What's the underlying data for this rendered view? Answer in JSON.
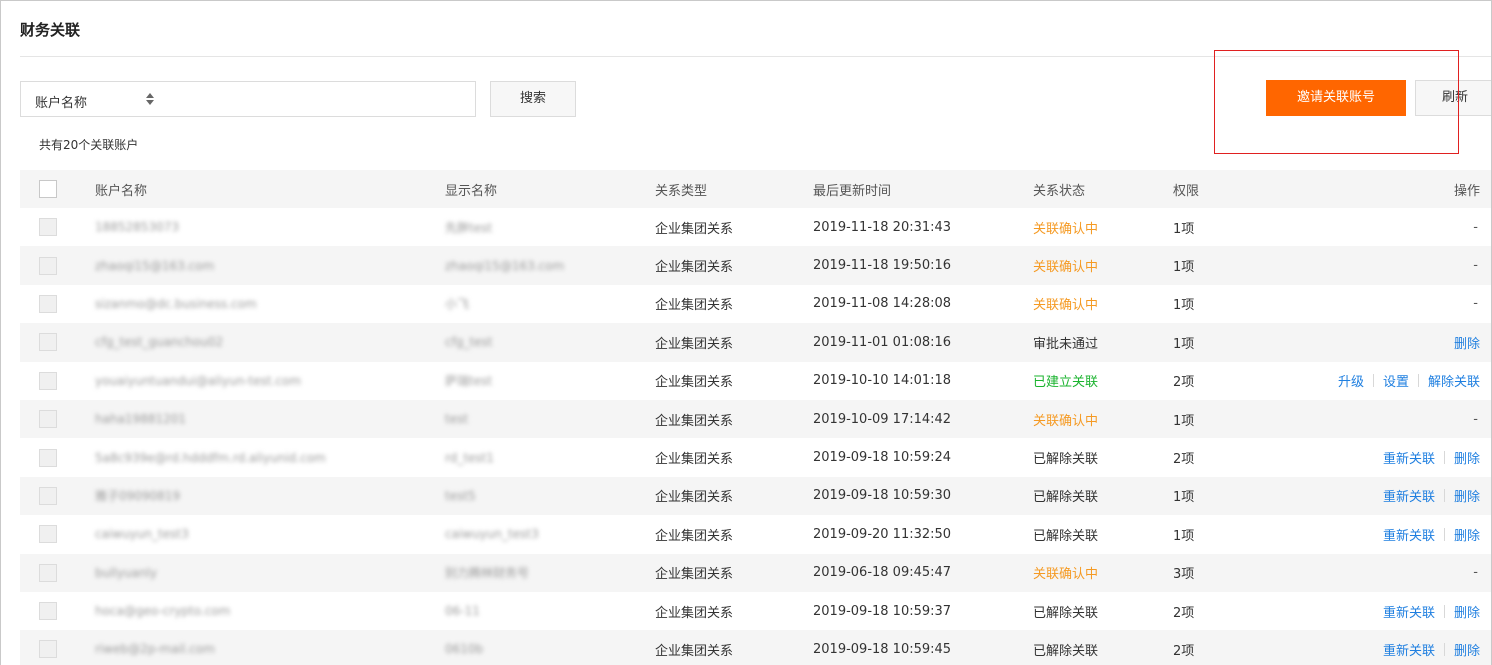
{
  "header": {
    "title": "财务关联"
  },
  "search": {
    "field_label": "账户名称",
    "search_button": "搜索"
  },
  "actions": {
    "invite_button": "邀请关联账号",
    "refresh_button": "刷新"
  },
  "summary": {
    "count_text": "共有20个关联账户"
  },
  "table": {
    "columns": [
      "账户名称",
      "显示名称",
      "关系类型",
      "最后更新时间",
      "关系状态",
      "权限",
      "操作"
    ],
    "rows": [
      {
        "account": "18852853073",
        "display": "先胖test",
        "type": "企业集团关系",
        "time": "2019-11-18 20:31:43",
        "status": "关联确认中",
        "status_kind": "pending",
        "perm": "1项",
        "ops": [
          "-"
        ]
      },
      {
        "account": "zhaoqi15@163.com",
        "display": "zhaoqi15@163.com",
        "type": "企业集团关系",
        "time": "2019-11-18 19:50:16",
        "status": "关联确认中",
        "status_kind": "pending",
        "perm": "1项",
        "ops": [
          "-"
        ]
      },
      {
        "account": "sizanmo@dc.business.com",
        "display": "小飞",
        "type": "企业集团关系",
        "time": "2019-11-08 14:28:08",
        "status": "关联确认中",
        "status_kind": "pending",
        "perm": "1项",
        "ops": [
          "-"
        ]
      },
      {
        "account": "cfg_test_guanchou02",
        "display": "cfg_test",
        "type": "企业集团关系",
        "time": "2019-11-01 01:08:16",
        "status": "审批未通过",
        "status_kind": "plain",
        "perm": "1项",
        "ops": [
          "删除"
        ]
      },
      {
        "account": "youaiyuntuandui@aliyun-test.com",
        "display": "萨瑞test",
        "type": "企业集团关系",
        "time": "2019-10-10 14:01:18",
        "status": "已建立关联",
        "status_kind": "ok",
        "perm": "2项",
        "ops": [
          "升级",
          "设置",
          "解除关联"
        ]
      },
      {
        "account": "haha19881201",
        "display": "test",
        "type": "企业集团关系",
        "time": "2019-10-09 17:14:42",
        "status": "关联确认中",
        "status_kind": "pending",
        "perm": "1项",
        "ops": [
          "-"
        ]
      },
      {
        "account": "5a8c939e@rd.hdddfm.rd.aliyunid.com",
        "display": "rd_test1",
        "type": "企业集团关系",
        "time": "2019-09-18 10:59:24",
        "status": "已解除关联",
        "status_kind": "plain",
        "perm": "2项",
        "ops": [
          "重新关联",
          "删除"
        ]
      },
      {
        "account": "雅子09090819",
        "display": "test5",
        "type": "企业集团关系",
        "time": "2019-09-18 10:59:30",
        "status": "已解除关联",
        "status_kind": "plain",
        "perm": "1项",
        "ops": [
          "重新关联",
          "删除"
        ]
      },
      {
        "account": "caiwuyun_test3",
        "display": "caiwuyun_test3",
        "type": "企业集团关系",
        "time": "2019-09-20 11:32:50",
        "status": "已解除关联",
        "status_kind": "plain",
        "perm": "1项",
        "ops": [
          "重新关联",
          "删除"
        ]
      },
      {
        "account": "bullyuanly",
        "display": "别力腾林财务号",
        "type": "企业集团关系",
        "time": "2019-06-18 09:45:47",
        "status": "关联确认中",
        "status_kind": "pending",
        "perm": "3项",
        "ops": [
          "-"
        ]
      },
      {
        "account": "hoca@geo-crypto.com",
        "display": "06-11",
        "type": "企业集团关系",
        "time": "2019-09-18 10:59:37",
        "status": "已解除关联",
        "status_kind": "plain",
        "perm": "2项",
        "ops": [
          "重新关联",
          "删除"
        ]
      },
      {
        "account": "riweb@2p-mail.com",
        "display": "0610b",
        "type": "企业集团关系",
        "time": "2019-09-18 10:59:45",
        "status": "已解除关联",
        "status_kind": "plain",
        "perm": "2项",
        "ops": [
          "重新关联",
          "删除"
        ]
      }
    ]
  },
  "colors": {
    "accent": "#ff6600",
    "link": "#1f7fe0",
    "pending": "#f59a23",
    "ok": "#1ab32e",
    "highlight": "#e02020"
  }
}
